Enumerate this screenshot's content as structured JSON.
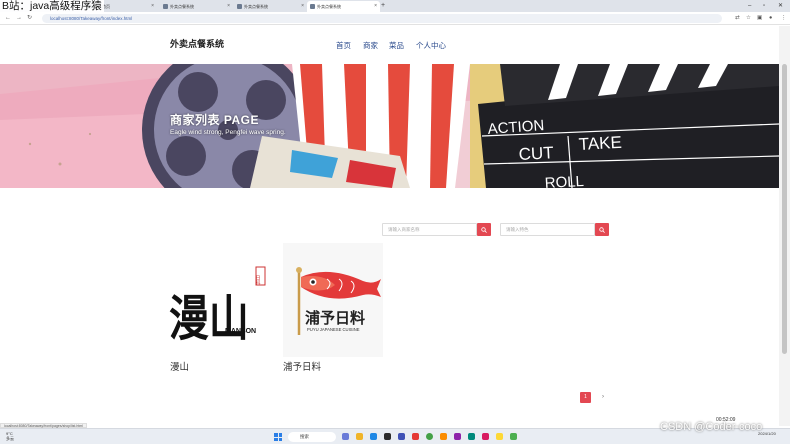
{
  "watermark": "B站：java高级程序猿",
  "browser": {
    "tabs": [
      {
        "title": "商城首页"
      },
      {
        "title": "外卖点餐系统"
      },
      {
        "title": "外卖点餐系统"
      },
      {
        "title": "外卖点餐系统"
      }
    ],
    "url": "localhost:8080/Takeaway/front/index.html"
  },
  "header": {
    "site_title": "外卖点餐系统",
    "nav": [
      "首页",
      "商家",
      "菜品",
      "个人中心"
    ]
  },
  "banner": {
    "title": "商家列表 PAGE",
    "subtitle": "Eagle wind strong, Pengfei wave spring.",
    "clapper_words": [
      "ACTION",
      "CUT",
      "TAKE",
      "ROLL"
    ]
  },
  "search": {
    "shop_placeholder": "请输入商家名称",
    "feature_placeholder": "请输入特色"
  },
  "shops": [
    {
      "name": "漫山",
      "logo_text": "漫山",
      "logo_sub": "MANSON",
      "seal": "日料"
    },
    {
      "name": "浦予日料",
      "logo_text": "浦予日料",
      "logo_sub": "PUYU JAPANESE CUISINE"
    }
  ],
  "pagination": {
    "current": "1",
    "next": "›"
  },
  "status": {
    "link": "localhost:8080/Takeaway/front/pages/shop/list.html"
  },
  "timer": "00:52:09",
  "overlay": "CSDN @Coder-coco",
  "taskbar": {
    "weather_temp": "9°C",
    "weather_desc": "多云",
    "search": "搜索",
    "date": "2024/1/20"
  },
  "colors": {
    "accent": "#e34852",
    "nav": "#2a4a8c"
  }
}
